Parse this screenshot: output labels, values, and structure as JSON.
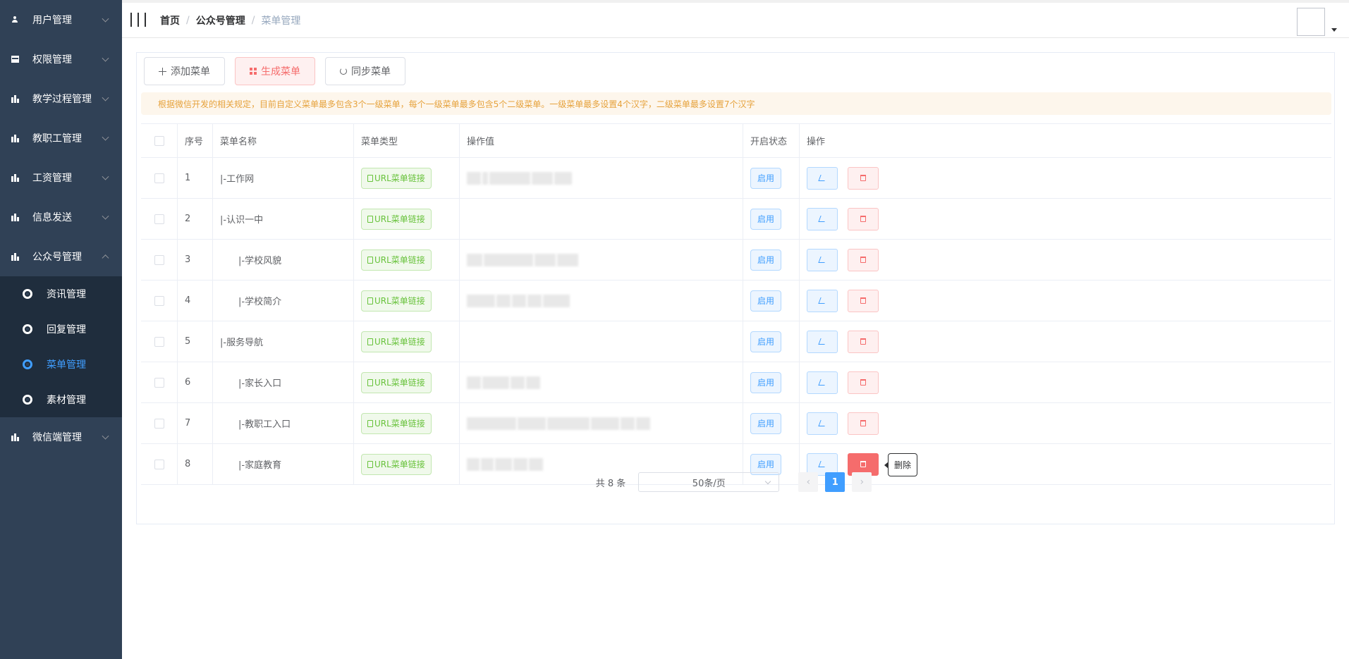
{
  "sidebar": {
    "items": [
      {
        "label": "用户管理",
        "icon": "user-icon"
      },
      {
        "label": "权限管理",
        "icon": "permission-icon"
      },
      {
        "label": "教学过程管理",
        "icon": "bar-chart-icon"
      },
      {
        "label": "教职工管理",
        "icon": "bar-chart-icon"
      },
      {
        "label": "工资管理",
        "icon": "bar-chart-icon"
      },
      {
        "label": "信息发送",
        "icon": "bar-chart-icon"
      },
      {
        "label": "公众号管理",
        "icon": "bar-chart-icon",
        "expanded": true
      },
      {
        "label": "微信端管理",
        "icon": "bar-chart-icon"
      }
    ],
    "sub_items": [
      {
        "label": "资讯管理"
      },
      {
        "label": "回复管理"
      },
      {
        "label": "菜单管理",
        "active": true
      },
      {
        "label": "素材管理"
      }
    ],
    "active_color": "#409eff",
    "background": "#304156"
  },
  "header": {
    "breadcrumb": [
      "首页",
      "公众号管理",
      "菜单管理"
    ],
    "separator": "/"
  },
  "toolbar": {
    "add_label": "添加菜单",
    "generate_label": "生成菜单",
    "sync_label": "同步菜单"
  },
  "alert": {
    "text": "根据微信开发的相关规定，目前自定义菜单最多包含3个一级菜单，每个一级菜单最多包含5个二级菜单。一级菜单最多设置4个汉字，二级菜单最多设置7个汉字"
  },
  "table": {
    "headers": {
      "index": "序号",
      "name": "菜单名称",
      "type": "菜单类型",
      "value": "操作值",
      "state": "开启状态",
      "actions": "操作"
    },
    "rows": [
      {
        "index": "1",
        "name": "|-工作网",
        "level": 1,
        "type": "URL菜单链接",
        "state": "启用",
        "value_redacted": true
      },
      {
        "index": "2",
        "name": "|-认识一中",
        "level": 1,
        "type": "URL菜单链接",
        "state": "启用",
        "value_redacted": false
      },
      {
        "index": "3",
        "name": "|-学校风貌",
        "level": 2,
        "type": "URL菜单链接",
        "state": "启用",
        "value_redacted": true
      },
      {
        "index": "4",
        "name": "|-学校简介",
        "level": 2,
        "type": "URL菜单链接",
        "state": "启用",
        "value_redacted": true
      },
      {
        "index": "5",
        "name": "|-服务导航",
        "level": 1,
        "type": "URL菜单链接",
        "state": "启用",
        "value_redacted": false
      },
      {
        "index": "6",
        "name": "|-家长入口",
        "level": 2,
        "type": "URL菜单链接",
        "state": "启用",
        "value_redacted": true
      },
      {
        "index": "7",
        "name": "|-教职工入口",
        "level": 2,
        "type": "URL菜单链接",
        "state": "启用",
        "value_redacted": true
      },
      {
        "index": "8",
        "name": "|-家庭教育",
        "level": 2,
        "type": "URL菜单链接",
        "state": "启用",
        "value_redacted": true
      }
    ]
  },
  "tooltip": {
    "text": "删除"
  },
  "pagination": {
    "total_text": "共 8 条",
    "page_size": "50条/页",
    "current_page": "1",
    "prev_icon": "chevron-left-icon",
    "next_icon": "chevron-right-icon"
  },
  "colors": {
    "primary": "#409eff",
    "danger": "#f56c6c",
    "success": "#67c23a",
    "warning": "#e6a23c"
  }
}
